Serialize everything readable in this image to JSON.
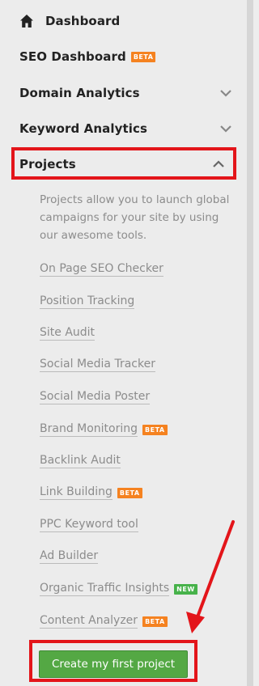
{
  "sidebar": {
    "dashboard_label": "Dashboard",
    "seo_dashboard_label": "SEO Dashboard",
    "seo_dashboard_badge": "BETA",
    "domain_analytics_label": "Domain Analytics",
    "keyword_analytics_label": "Keyword Analytics",
    "projects_label": "Projects"
  },
  "projects": {
    "description": "Projects allow you to launch global campaigns for your site by using our awesome tools.",
    "links": [
      {
        "label": "On Page SEO Checker",
        "badge": ""
      },
      {
        "label": "Position Tracking",
        "badge": ""
      },
      {
        "label": "Site Audit",
        "badge": ""
      },
      {
        "label": "Social Media Tracker",
        "badge": ""
      },
      {
        "label": "Social Media Poster",
        "badge": ""
      },
      {
        "label": "Brand Monitoring",
        "badge": "BETA"
      },
      {
        "label": "Backlink Audit",
        "badge": ""
      },
      {
        "label": "Link Building",
        "badge": "BETA"
      },
      {
        "label": "PPC Keyword tool",
        "badge": ""
      },
      {
        "label": "Ad Builder",
        "badge": ""
      },
      {
        "label": "Organic Traffic Insights",
        "badge": "NEW"
      },
      {
        "label": "Content Analyzer",
        "badge": "BETA"
      }
    ],
    "create_button_label": "Create my first project"
  },
  "colors": {
    "highlight": "#e3151a",
    "beta_badge": "#f58220",
    "new_badge": "#47b24a",
    "cta_green": "#54a844"
  },
  "icons": {
    "dashboard": "home-icon",
    "collapsed": "chevron-down-icon",
    "expanded": "chevron-up-icon"
  }
}
